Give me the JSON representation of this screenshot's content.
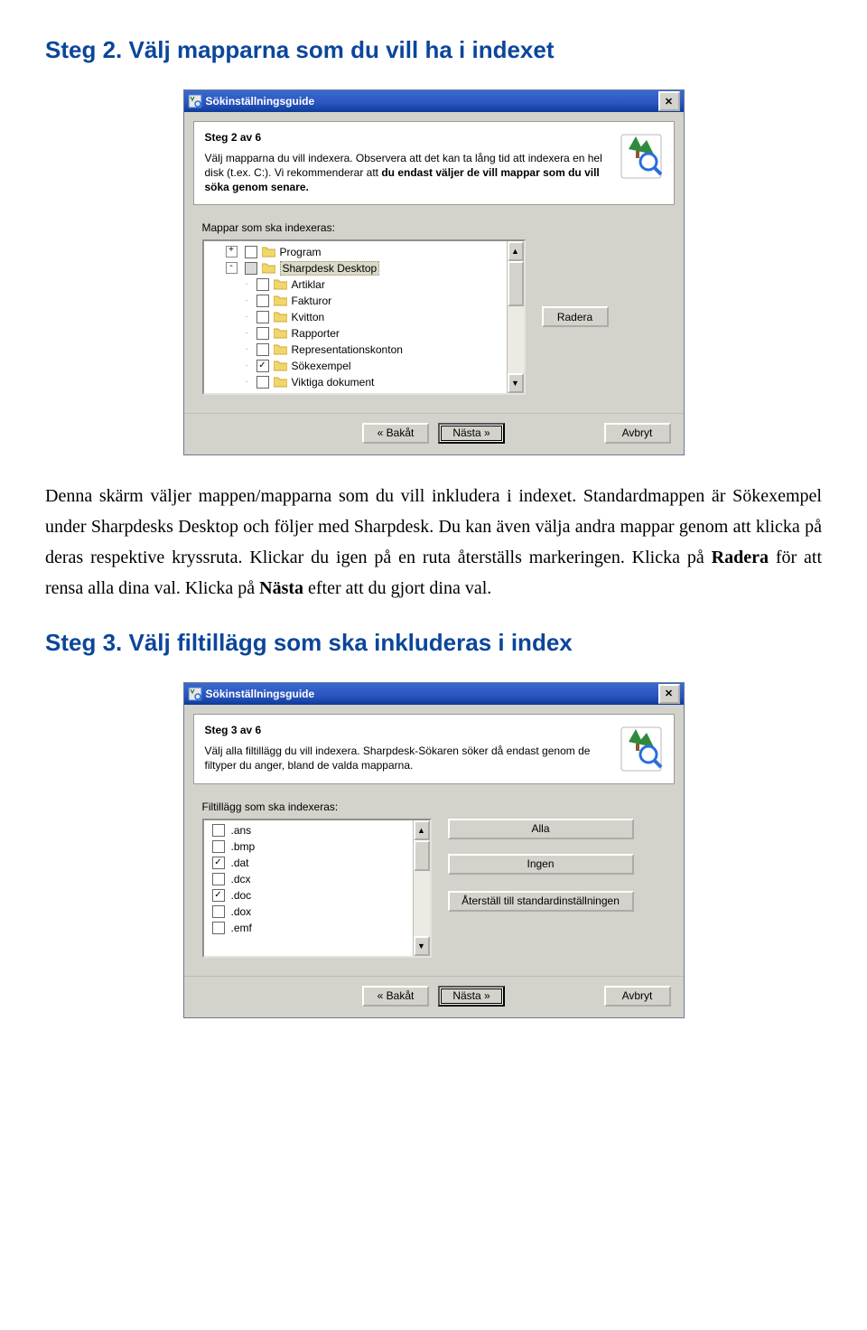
{
  "heading1": "Steg 2. Välj mapparna som du vill ha i indexet",
  "para1_a": "Denna skärm väljer mappen/mapparna som du vill inkludera i indexet. Standardmappen är Sökexempel under Sharpdesks Desktop och följer med Sharpdesk. Du kan även välja andra mappar genom att klicka på deras respektive kryssruta. Klickar du igen på en ruta återställs markeringen. Klicka på ",
  "para1_b": "Radera",
  "para1_c": " för att rensa alla dina val. Klicka på ",
  "para1_d": "Nästa",
  "para1_e": " efter att du gjort dina val.",
  "heading2": "Steg 3. Välj filtillägg som ska inkluderas i index",
  "dialog1": {
    "title": "Sökinställningsguide",
    "step": "Steg 2 av 6",
    "desc_a": "Välj mapparna du vill indexera. Observera att det kan ta lång tid att indexera en hel disk (t.ex. C:). Vi rekommenderar att ",
    "desc_b": "du endast väljer de vill mappar som du vill söka genom senare.",
    "label": "Mappar som ska indexeras:",
    "items": {
      "0": "Program",
      "1": "Sharpdesk Desktop",
      "2": "Artiklar",
      "3": "Fakturor",
      "4": "Kvitton",
      "5": "Rapporter",
      "6": "Representationskonton",
      "7": "Sökexempel",
      "8": "Viktiga dokument"
    },
    "delete": "Radera",
    "back": "« Bakåt",
    "next": "Nästa »",
    "cancel": "Avbryt"
  },
  "dialog2": {
    "title": "Sökinställningsguide",
    "step": "Steg 3 av 6",
    "desc": "Välj alla filtillägg du vill indexera. Sharpdesk-Sökaren söker då endast genom de filtyper du anger, bland de valda mapparna.",
    "label": "Filtillägg som ska indexeras:",
    "ext": {
      "0": ".ans",
      "1": ".bmp",
      "2": ".dat",
      "3": ".dcx",
      "4": ".doc",
      "5": ".dox",
      "6": ".emf"
    },
    "all": "Alla",
    "none": "Ingen",
    "reset": "Återställ till standardinställningen",
    "back": "« Bakåt",
    "next": "Nästa »",
    "cancel": "Avbryt"
  }
}
